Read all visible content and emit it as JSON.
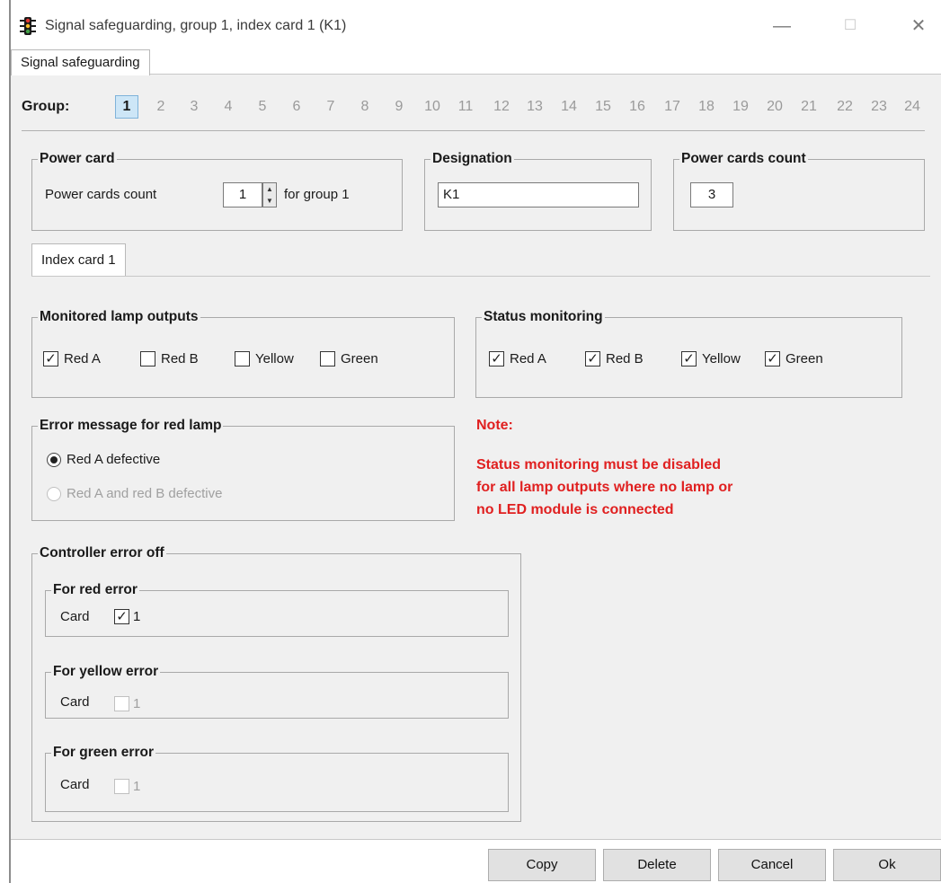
{
  "window": {
    "title": "Signal safeguarding, group  1, index card  1 (K1)",
    "icon": "traffic-light-icon",
    "minimize": "—",
    "maximize": "☐",
    "close": "✕"
  },
  "tabs": {
    "main": "Signal safeguarding",
    "index": "Index card 1"
  },
  "group": {
    "label": "Group:",
    "numbers": [
      "1",
      "2",
      "3",
      "4",
      "5",
      "6",
      "7",
      "8",
      "9",
      "10",
      "11",
      "12",
      "13",
      "14",
      "15",
      "16",
      "17",
      "18",
      "19",
      "20",
      "21",
      "22",
      "23",
      "24"
    ],
    "selected": "1"
  },
  "power_card": {
    "legend": "Power card",
    "count_label": "Power cards count",
    "count_value": "1",
    "for_group": "for group  1"
  },
  "designation": {
    "legend": "Designation",
    "value": "K1"
  },
  "power_cards_count": {
    "legend": "Power cards count",
    "value": "3"
  },
  "monitored": {
    "legend": "Monitored lamp outputs",
    "items": [
      {
        "label": "Red A",
        "checked": true
      },
      {
        "label": "Red B",
        "checked": false
      },
      {
        "label": "Yellow",
        "checked": false
      },
      {
        "label": "Green",
        "checked": false
      }
    ]
  },
  "status": {
    "legend": "Status monitoring",
    "items": [
      {
        "label": "Red A",
        "checked": true
      },
      {
        "label": "Red B",
        "checked": true
      },
      {
        "label": "Yellow",
        "checked": true
      },
      {
        "label": "Green",
        "checked": true
      }
    ]
  },
  "error_msg": {
    "legend": "Error message for red lamp",
    "option1": "Red A defective",
    "option2": "Red A and red B defective"
  },
  "note": {
    "title": "Note:",
    "line1": "Status monitoring must be disabled",
    "line2": "for all lamp outputs where no lamp or",
    "line3": "no LED module is connected"
  },
  "controller": {
    "legend": "Controller error off",
    "red": {
      "legend": "For red error",
      "card_label": "Card",
      "value": "1",
      "checked": true
    },
    "yellow": {
      "legend": "For yellow error",
      "card_label": "Card",
      "value": "1",
      "checked": false
    },
    "green": {
      "legend": "For green error",
      "card_label": "Card",
      "value": "1",
      "checked": false
    }
  },
  "buttons": {
    "copy": "Copy",
    "delete": "Delete",
    "cancel": "Cancel",
    "ok": "Ok"
  },
  "colors": {
    "note": "#e02020",
    "selected_group_bg": "#cde6f7",
    "dialog_bg": "#f0f0f0"
  }
}
